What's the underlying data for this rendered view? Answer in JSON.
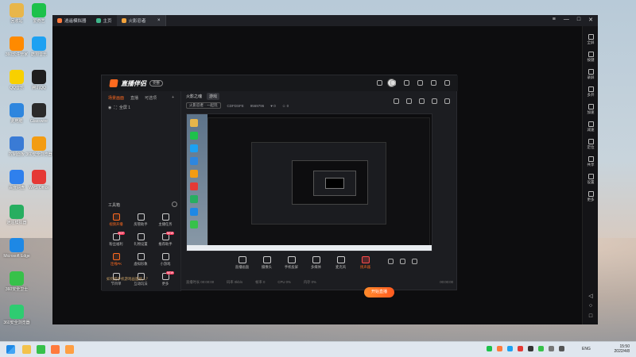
{
  "desktop": {
    "icons": [
      {
        "label": "回收站",
        "color": "#e8b64a"
      },
      {
        "label": "爱奇艺",
        "color": "#1dc14b"
      },
      {
        "label": "360软件管家",
        "color": "#ff8a00"
      },
      {
        "label": "酷狗音乐",
        "color": "#1da1f2"
      },
      {
        "label": "QQ音乐",
        "color": "#f8d000"
      },
      {
        "label": "腾讯QQ",
        "color": "#1e1e1e"
      },
      {
        "label": "此电脑",
        "color": "#2e86de"
      },
      {
        "label": "Glasswire",
        "color": "#2b2b2b"
      },
      {
        "label": "控制面板",
        "color": "#3a7bd5"
      },
      {
        "label": "360安全浏览器",
        "color": "#f39c12"
      },
      {
        "label": "百度网盘",
        "color": "#2f80ed"
      },
      {
        "label": "WPS Office",
        "color": "#e53935"
      },
      {
        "label": "逍遥模拟器",
        "color": "#27ae60"
      },
      {
        "label": "Microsoft Edge",
        "color": "#1e88e5"
      },
      {
        "label": "360安全卫士",
        "color": "#37c14a"
      },
      {
        "label": "360安全浏览器",
        "color": "#2ecc71"
      }
    ]
  },
  "emulator": {
    "tabs": [
      {
        "label": "逍遥模拟器"
      },
      {
        "label": "主页"
      },
      {
        "label": "火影忍者",
        "active": true
      }
    ],
    "window_controls": [
      "≡",
      "—",
      "□",
      "✕"
    ],
    "sidebar": [
      {
        "label": "全屏"
      },
      {
        "label": "按键"
      },
      {
        "label": "录屏"
      },
      {
        "label": "多开"
      },
      {
        "label": "加速"
      },
      {
        "label": "减速"
      },
      {
        "label": "定位"
      },
      {
        "label": "共享"
      },
      {
        "label": "设置"
      },
      {
        "label": "更多"
      }
    ],
    "nav": [
      "◁",
      "○",
      "□"
    ]
  },
  "app": {
    "brand": "直播伴侣",
    "badge": "完整",
    "left_tabs": [
      {
        "label": "场景画面",
        "active": true
      },
      {
        "label": "直播"
      },
      {
        "label": "可选项"
      }
    ],
    "scene_row": "全屏 1",
    "tools_title": "工具箱",
    "tools": [
      {
        "label": "视频开播",
        "hot": true
      },
      {
        "label": "房管助手"
      },
      {
        "label": "主播任务"
      },
      {
        "label": "粉丝福利",
        "tag": "HOT"
      },
      {
        "label": "礼物设置"
      },
      {
        "label": "推荐助手",
        "tag": "NEW"
      },
      {
        "label": "连线PK",
        "hot": true
      },
      {
        "label": "虚拟形象"
      },
      {
        "label": "小游戏"
      },
      {
        "label": "节目单"
      },
      {
        "label": "互动玩法"
      },
      {
        "label": "更多",
        "tag": "NEW"
      }
    ],
    "left_footer": "如何把手机游戏画面接入？",
    "header": {
      "title": "火影之魂",
      "chip": "游戏"
    },
    "sub": {
      "chip": "火影忍者 · 一起玩",
      "id": "CDFDSFE",
      "num": "9569796",
      "likes": "0",
      "viewers": "0"
    },
    "bottom": [
      {
        "label": "直播画面"
      },
      {
        "label": "摄像头"
      },
      {
        "label": "手机投屏"
      },
      {
        "label": "多媒体"
      },
      {
        "label": "麦克风"
      },
      {
        "label": "扬声器",
        "red": true
      }
    ],
    "go_live": "开始直播",
    "stats": [
      "直播时长 00:00:00",
      "码率 0kb/s",
      "帧率 0",
      "CPU 0%",
      "内存 0%"
    ],
    "timer": "00:00:00"
  },
  "taskbar": {
    "time": "15:50",
    "date": "2022/4/8",
    "lang": "ENG"
  }
}
